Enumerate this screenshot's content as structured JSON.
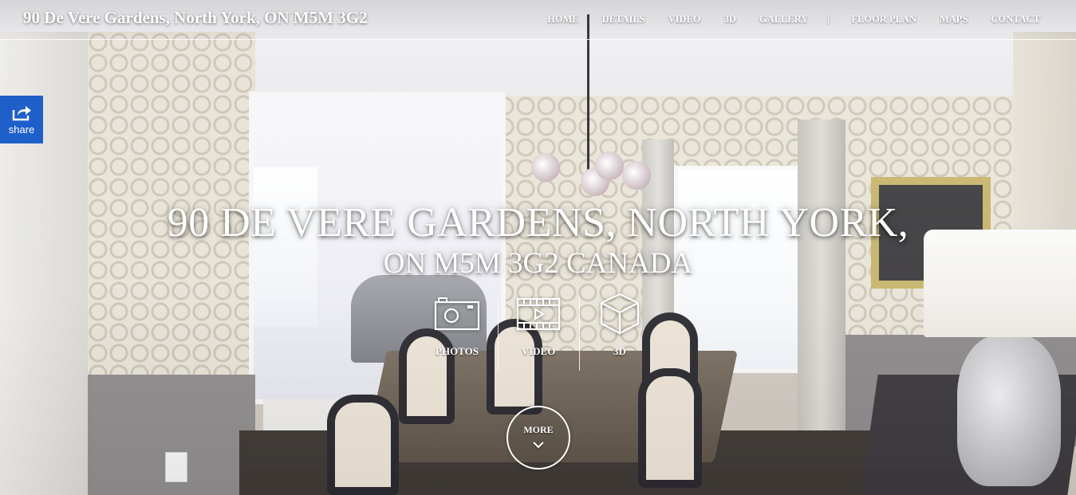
{
  "header": {
    "site_title": "90 De Vere Gardens, North York, ON M5M 3G2",
    "nav": [
      {
        "label": "HOME"
      },
      {
        "label": "DETAILS"
      },
      {
        "label": "VIDEO"
      },
      {
        "label": "3D"
      },
      {
        "label": "GALLERY"
      },
      {
        "label": "FLOOR PLAN"
      },
      {
        "label": "MAPS"
      },
      {
        "label": "CONTACT"
      }
    ],
    "separator": "|"
  },
  "share": {
    "label": "share",
    "icon": "share-icon",
    "color": "#1f5fc9"
  },
  "hero": {
    "line1": "90 DE VERE GARDENS, NORTH YORK,",
    "line2": "ON M5M 3G2 CANADA"
  },
  "media": [
    {
      "label": "PHOTOS",
      "icon": "camera-icon"
    },
    {
      "label": "VIDEO",
      "icon": "film-icon"
    },
    {
      "label": "3D",
      "icon": "cube-icon"
    }
  ],
  "more": {
    "label": "MORE",
    "icon": "chevron-down-icon"
  }
}
